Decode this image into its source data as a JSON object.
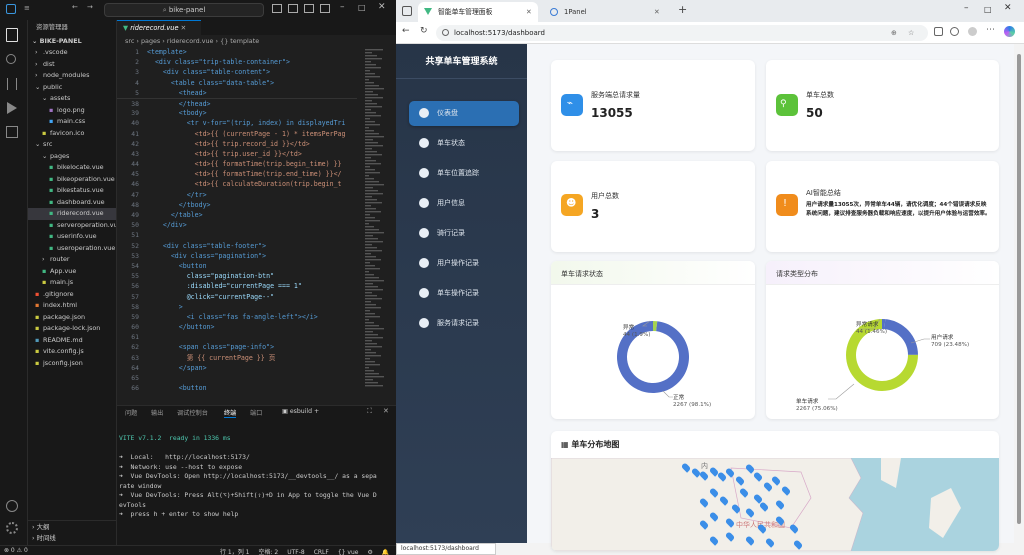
{
  "vscode": {
    "window_title": "bike-panel",
    "explorer_title": "资源管理器",
    "root": "BIKE-PANEL",
    "tree": [
      {
        "label": ".vscode",
        "indent": 1,
        "kind": "folder-closed"
      },
      {
        "label": "dist",
        "indent": 1,
        "kind": "folder-closed"
      },
      {
        "label": "node_modules",
        "indent": 1,
        "kind": "folder-closed"
      },
      {
        "label": "public",
        "indent": 1,
        "kind": "folder-open"
      },
      {
        "label": "assets",
        "indent": 2,
        "kind": "folder-open"
      },
      {
        "label": "logo.png",
        "indent": 3,
        "kind": "img"
      },
      {
        "label": "main.css",
        "indent": 3,
        "kind": "css"
      },
      {
        "label": "favicon.ico",
        "indent": 2,
        "kind": "ico"
      },
      {
        "label": "src",
        "indent": 1,
        "kind": "folder-open"
      },
      {
        "label": "pages",
        "indent": 2,
        "kind": "folder-open"
      },
      {
        "label": "bikelocate.vue",
        "indent": 3,
        "kind": "vue"
      },
      {
        "label": "bikeoperation.vue",
        "indent": 3,
        "kind": "vue"
      },
      {
        "label": "bikestatus.vue",
        "indent": 3,
        "kind": "vue"
      },
      {
        "label": "dashboard.vue",
        "indent": 3,
        "kind": "vue"
      },
      {
        "label": "riderecord.vue",
        "indent": 3,
        "kind": "vue",
        "selected": true
      },
      {
        "label": "serveroperation.vue",
        "indent": 3,
        "kind": "vue"
      },
      {
        "label": "userinfo.vue",
        "indent": 3,
        "kind": "vue"
      },
      {
        "label": "useroperation.vue",
        "indent": 3,
        "kind": "vue"
      },
      {
        "label": "router",
        "indent": 2,
        "kind": "folder-closed"
      },
      {
        "label": "App.vue",
        "indent": 2,
        "kind": "vue"
      },
      {
        "label": "main.js",
        "indent": 2,
        "kind": "js"
      },
      {
        "label": ".gitignore",
        "indent": 1,
        "kind": "git"
      },
      {
        "label": "index.html",
        "indent": 1,
        "kind": "html"
      },
      {
        "label": "package.json",
        "indent": 1,
        "kind": "json"
      },
      {
        "label": "package-lock.json",
        "indent": 1,
        "kind": "json"
      },
      {
        "label": "README.md",
        "indent": 1,
        "kind": "md"
      },
      {
        "label": "vite.config.js",
        "indent": 1,
        "kind": "js"
      },
      {
        "label": "jsconfig.json",
        "indent": 1,
        "kind": "json"
      }
    ],
    "outline_label": "大纲",
    "timeline_label": "时间线",
    "tab_name": "riderecord.vue",
    "breadcrumb": [
      "src",
      "pages",
      "riderecord.vue",
      "{} template"
    ],
    "code": [
      {
        "n": "1",
        "t": "<template>"
      },
      {
        "n": "2",
        "t": "  <div class=\"trip-table-container\">"
      },
      {
        "n": "3",
        "t": "    <div class=\"table-content\">"
      },
      {
        "n": "4",
        "t": "      <table class=\"data-table\">"
      },
      {
        "n": "5",
        "t": "        <thead>"
      },
      {
        "n": "38",
        "t": "        </thead>"
      },
      {
        "n": "39",
        "t": "        <tbody>"
      },
      {
        "n": "40",
        "t": "          <tr v-for=\"(trip, index) in displayedTri"
      },
      {
        "n": "41",
        "t": "            <td>{{ (currentPage - 1) * itemsPerPag"
      },
      {
        "n": "42",
        "t": "            <td>{{ trip.record_id }}</td>"
      },
      {
        "n": "43",
        "t": "            <td>{{ trip.user_id }}</td>"
      },
      {
        "n": "44",
        "t": "            <td>{{ formatTime(trip.begin_time) }}"
      },
      {
        "n": "45",
        "t": "            <td>{{ formatTime(trip.end_time) }}</"
      },
      {
        "n": "46",
        "t": "            <td>{{ calculateDuration(trip.begin_t"
      },
      {
        "n": "47",
        "t": "          </tr>"
      },
      {
        "n": "48",
        "t": "        </tbody>"
      },
      {
        "n": "49",
        "t": "      </table>"
      },
      {
        "n": "50",
        "t": "    </div>"
      },
      {
        "n": "51",
        "t": ""
      },
      {
        "n": "52",
        "t": "    <div class=\"table-footer\">"
      },
      {
        "n": "53",
        "t": "      <div class=\"pagination\">"
      },
      {
        "n": "54",
        "t": "        <button"
      },
      {
        "n": "55",
        "t": "          class=\"pagination-btn\""
      },
      {
        "n": "56",
        "t": "          :disabled=\"currentPage === 1\""
      },
      {
        "n": "57",
        "t": "          @click=\"currentPage--\""
      },
      {
        "n": "58",
        "t": "        >"
      },
      {
        "n": "59",
        "t": "          <i class=\"fas fa-angle-left\"></i>"
      },
      {
        "n": "60",
        "t": "        </button>"
      },
      {
        "n": "61",
        "t": ""
      },
      {
        "n": "62",
        "t": "        <span class=\"page-info\">"
      },
      {
        "n": "63",
        "t": "          第 {{ currentPage }} 页"
      },
      {
        "n": "64",
        "t": "        </span>"
      },
      {
        "n": "65",
        "t": ""
      },
      {
        "n": "66",
        "t": "        <button"
      }
    ],
    "panel_tabs": [
      "问题",
      "输出",
      "调试控制台",
      "终端",
      "端口"
    ],
    "panel_active": "终端",
    "terminal_name": "esbuild",
    "terminal": [
      "VITE v7.1.2  ready in 1336 ms",
      "",
      "➜  Local:   http://localhost:5173/",
      "➜  Network: use --host to expose",
      "➜  Vue DevTools: Open http://localhost:5173/__devtools__/ as a sepa",
      "rate window",
      "➜  Vue DevTools: Press Alt(⌥)+Shift(⇧)+D in App to toggle the Vue D",
      "evTools",
      "➜  press h + enter to show help"
    ],
    "status_left": "⊗ 0 ⚠ 0",
    "status_right": [
      "行 1，列 1",
      "空格: 2",
      "UTF-8",
      "CRLF",
      "{} vue",
      "⚙",
      "🔔"
    ]
  },
  "browser": {
    "tabs": [
      {
        "label": "智能单车管理面板",
        "active": true
      },
      {
        "label": "1Panel",
        "active": false
      }
    ],
    "new_tab": "+",
    "url": "localhost:5173/dashboard",
    "status_url": "localhost:5173/dashboard"
  },
  "app": {
    "title": "共享单车管理系统",
    "nav": [
      {
        "label": "仪表盘",
        "icon": "gauge-icon",
        "active": true
      },
      {
        "label": "单车状态",
        "icon": "bike-icon",
        "active": false
      },
      {
        "label": "单车位置追踪",
        "icon": "location-icon",
        "active": false
      },
      {
        "label": "用户信息",
        "icon": "user-icon",
        "active": false
      },
      {
        "label": "骑行记录",
        "icon": "clock-icon",
        "active": false
      },
      {
        "label": "用户操作记录",
        "icon": "file-icon",
        "active": false
      },
      {
        "label": "单车操作记录",
        "icon": "cogs-icon",
        "active": false
      },
      {
        "label": "服务请求记录",
        "icon": "headset-icon",
        "active": false
      }
    ],
    "stats": [
      {
        "label": "服务端总请求量",
        "value": "13055",
        "color": "#2f8fe8"
      },
      {
        "label": "单车总数",
        "value": "50",
        "color": "#5cc23a"
      },
      {
        "label": "用户总数",
        "value": "3",
        "color": "#f5a623"
      }
    ],
    "ai": {
      "title": "AI智能总结",
      "color": "#f08c1c",
      "text": "用户请求量13055次，异常单车44辆，请优化调度；44个错误请求反映系统问题，建议排查服务器负载和响应速度，以提升用户体验与运营效率。"
    },
    "map_title": "单车分布地图",
    "map_labels": [
      "内",
      "中华人民共和国"
    ]
  },
  "chart_data": [
    {
      "type": "pie",
      "title": "单车请求状态",
      "labels": [
        "异常",
        "正常"
      ],
      "values": [
        44,
        2267
      ],
      "value_labels": [
        "44 (1.9%)",
        "2267 (98.1%)"
      ],
      "colors": [
        "#a5d34f",
        "#5470c6"
      ]
    },
    {
      "type": "pie",
      "title": "请求类型分布",
      "labels": [
        "异常请求",
        "用户请求",
        "单车请求"
      ],
      "values": [
        44,
        709,
        2267
      ],
      "value_labels": [
        "44 (1.46%)",
        "709 (23.48%)",
        "2267 (75.06%)"
      ],
      "colors": [
        "#5470c6",
        "#5470c6",
        "#b7d931"
      ]
    }
  ]
}
